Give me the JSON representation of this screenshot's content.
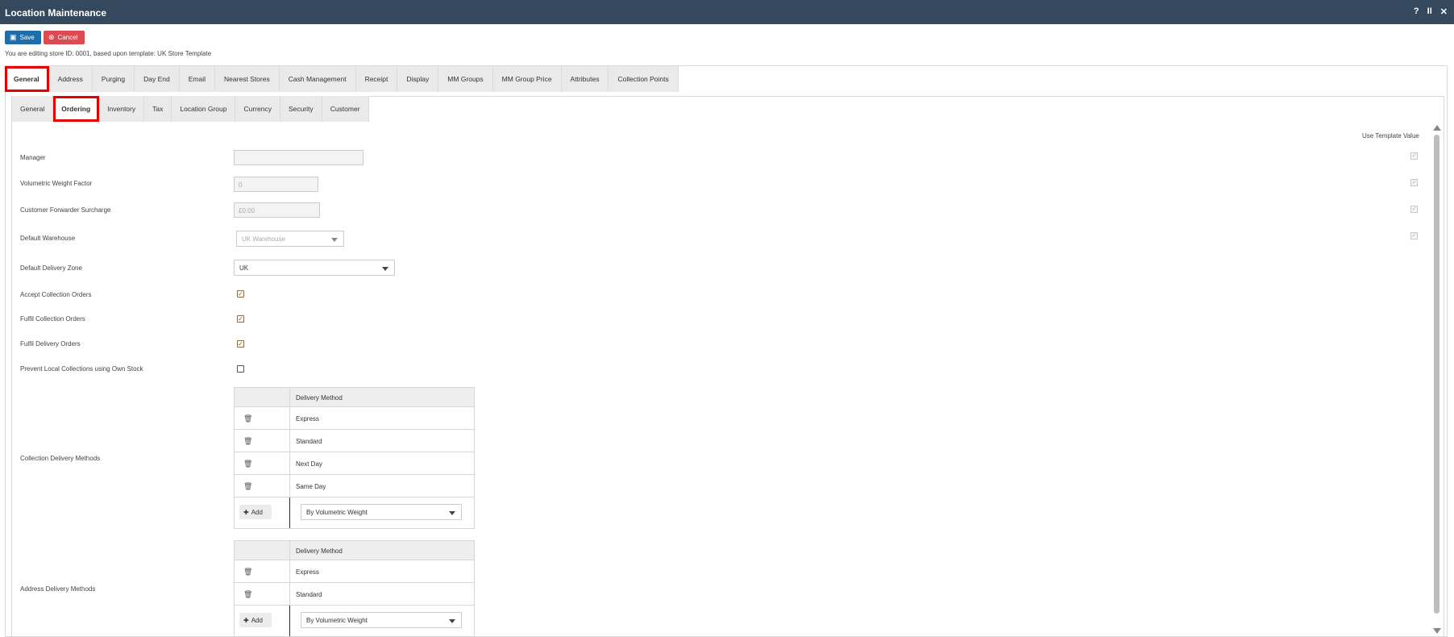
{
  "window": {
    "title": "Location Maintenance",
    "controls": [
      "?",
      "II",
      "✕"
    ]
  },
  "toolbar": {
    "save_label": "Save",
    "cancel_label": "Cancel"
  },
  "editing_note": "You are editing store ID: 0001, based upon template: UK Store Template",
  "main_tabs": [
    "General",
    "Address",
    "Purging",
    "Day End",
    "Email",
    "Nearest Stores",
    "Cash Management",
    "Receipt",
    "Display",
    "MM Groups",
    "MM Group Price",
    "Attributes",
    "Collection Points"
  ],
  "sub_tabs": [
    "General",
    "Ordering",
    "Inventory",
    "Tax",
    "Location Group",
    "Currency",
    "Security",
    "Customer"
  ],
  "use_template_value_label": "Use Template Value",
  "fields": {
    "manager": {
      "label": "Manager",
      "value": ""
    },
    "volumetric_weight_factor": {
      "label": "Volumetric Weight Factor",
      "value": "0"
    },
    "customer_forwarder_surcharge": {
      "label": "Customer Forwarder Surcharge",
      "value": "£0.00"
    },
    "default_warehouse": {
      "label": "Default Warehouse",
      "value": "UK Warehouse"
    },
    "default_delivery_zone": {
      "label": "Default Delivery Zone",
      "value": "UK"
    },
    "accept_collection_orders": {
      "label": "Accept Collection Orders",
      "checked": true
    },
    "fulfil_collection_orders": {
      "label": "Fulfil Collection Orders",
      "checked": true
    },
    "fulfil_delivery_orders": {
      "label": "Fulfil Delivery Orders",
      "checked": true
    },
    "prevent_local_collections": {
      "label": "Prevent Local Collections using Own Stock",
      "checked": false
    }
  },
  "collection_delivery_methods": {
    "label": "Collection Delivery Methods",
    "header": "Delivery Method",
    "rows": [
      "Express",
      "Standard",
      "Next Day",
      "Same Day"
    ],
    "add_label": "Add",
    "select_value": "By Volumetric Weight"
  },
  "address_delivery_methods": {
    "label": "Address Delivery Methods",
    "header": "Delivery Method",
    "rows": [
      "Express",
      "Standard"
    ],
    "add_label": "Add",
    "select_value": "By Volumetric Weight"
  },
  "colors": {
    "titlebar": "#34495e",
    "save": "#1f6eaa",
    "cancel": "#dc4b51",
    "highlight": "#e40000"
  }
}
